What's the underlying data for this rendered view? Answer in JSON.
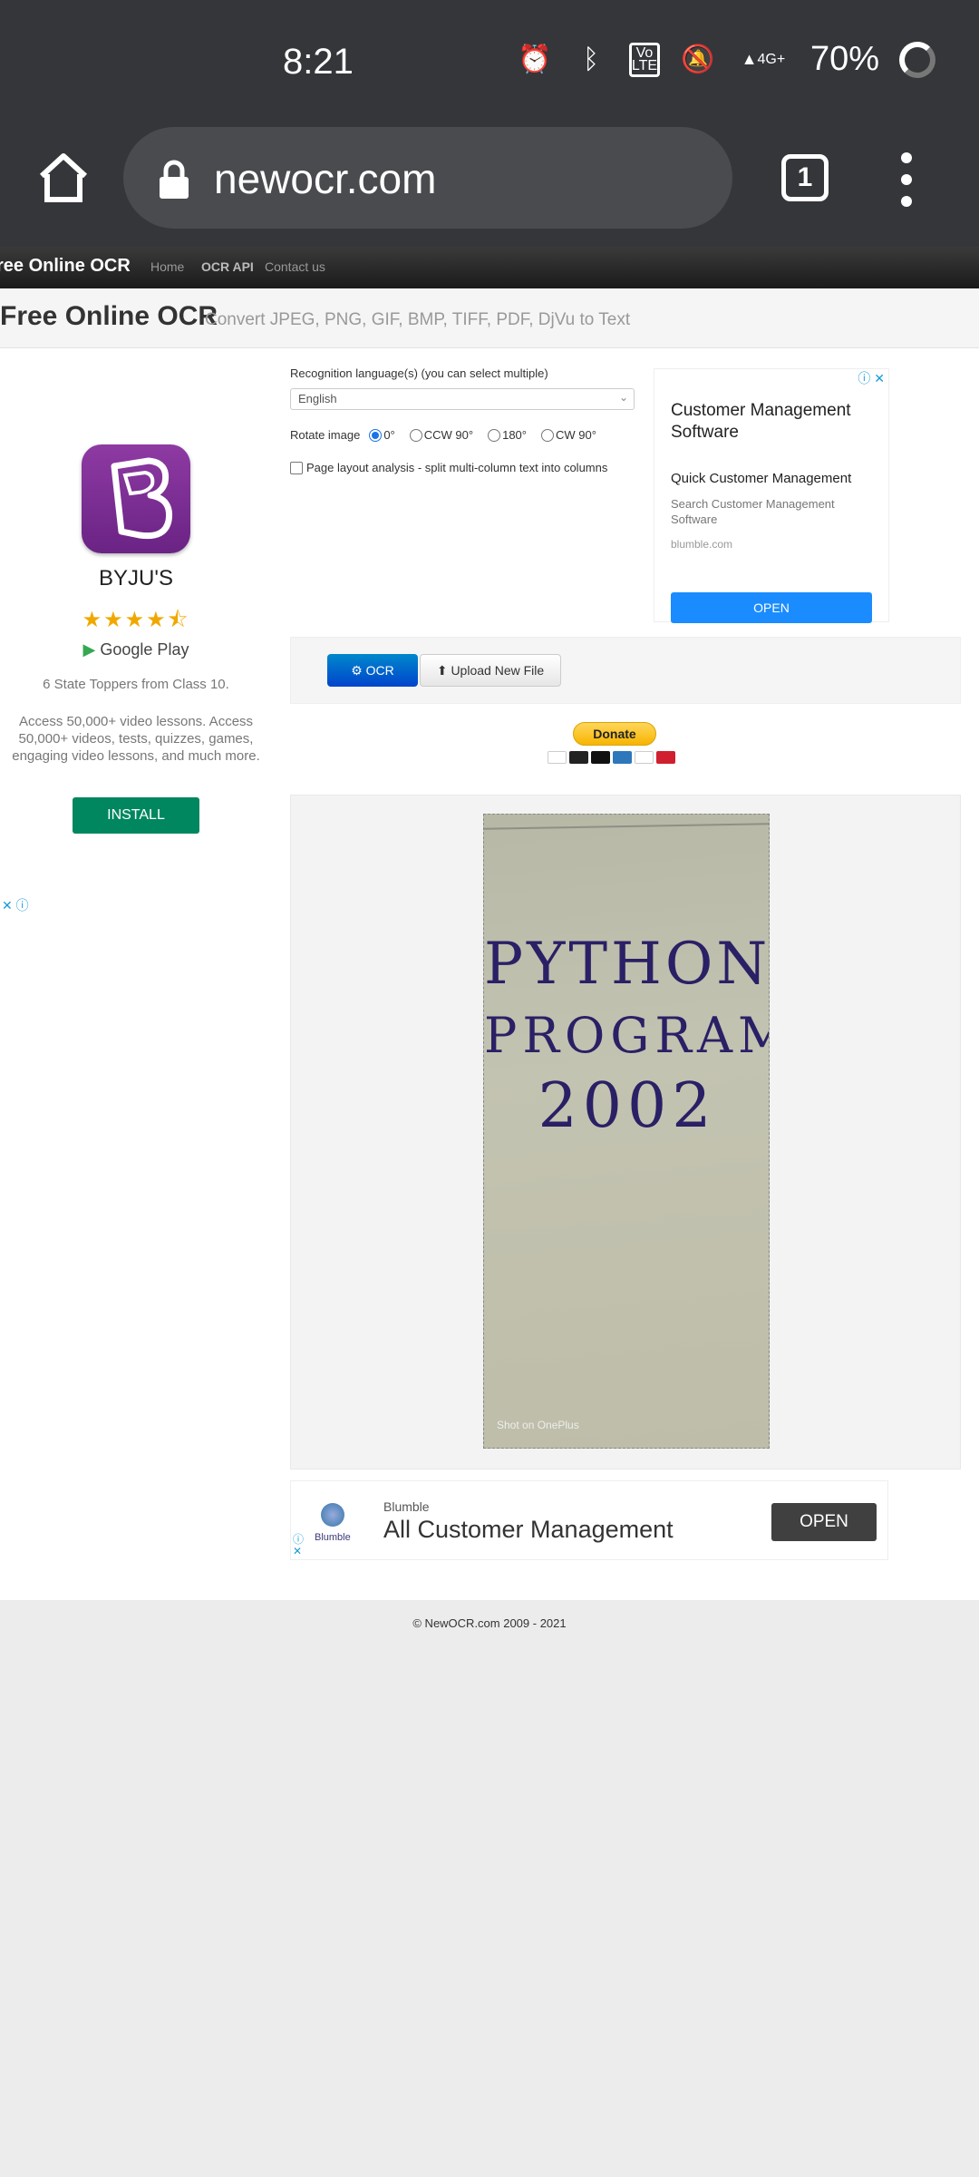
{
  "status": {
    "time": "8:21",
    "battery": "70%",
    "network": "4G+"
  },
  "browser": {
    "url": "newocr.com",
    "tab_count": "1"
  },
  "nav": {
    "brand": "ree Online OCR",
    "links": [
      "Home",
      "OCR API",
      "Contact us"
    ]
  },
  "header": {
    "title": "Free Online OCR",
    "subtitle": "Convert JPEG, PNG, GIF, BMP, TIFF, PDF, DjVu to Text"
  },
  "left_ad": {
    "app_name": "BYJU'S",
    "rating": "★★★★⯪",
    "store": "Google Play",
    "tagline": "6 State Toppers from Class 10.",
    "description": "Access 50,000+ video lessons. Access 50,000+ videos, tests, quizzes, games, engaging video lessons, and much more.",
    "install_label": "INSTALL",
    "close": "✕ ⓘ"
  },
  "form": {
    "language_label": "Recognition language(s) (you can select multiple)",
    "language_value": "English",
    "rotate_label": "Rotate image",
    "rotate_options": [
      "0°",
      "CCW 90°",
      "180°",
      "CW 90°"
    ],
    "rotate_selected": "0°",
    "layout_label": "Page layout analysis - split multi-column text into columns"
  },
  "right_ad": {
    "title": "Customer Management Software",
    "subtitle": "Quick Customer Management",
    "text": "Search Customer Management Software",
    "domain": "blumble.com",
    "open_label": "OPEN",
    "choices": "ⓘ ✕"
  },
  "buttons": {
    "ocr": "⚙ OCR",
    "upload": "⬆ Upload New File"
  },
  "donate": {
    "label": "Donate"
  },
  "preview": {
    "lines": [
      "PYTHON",
      "PROGRAM",
      "2002"
    ],
    "watermark": "Shot on OnePlus"
  },
  "bottom_ad": {
    "logo_text": "Blumble",
    "brand": "Blumble",
    "title": "All Customer Management",
    "open_label": "OPEN",
    "choices": "ⓘ\n✕"
  },
  "footer": {
    "copyright": "© NewOCR.com 2009 - 2021"
  }
}
